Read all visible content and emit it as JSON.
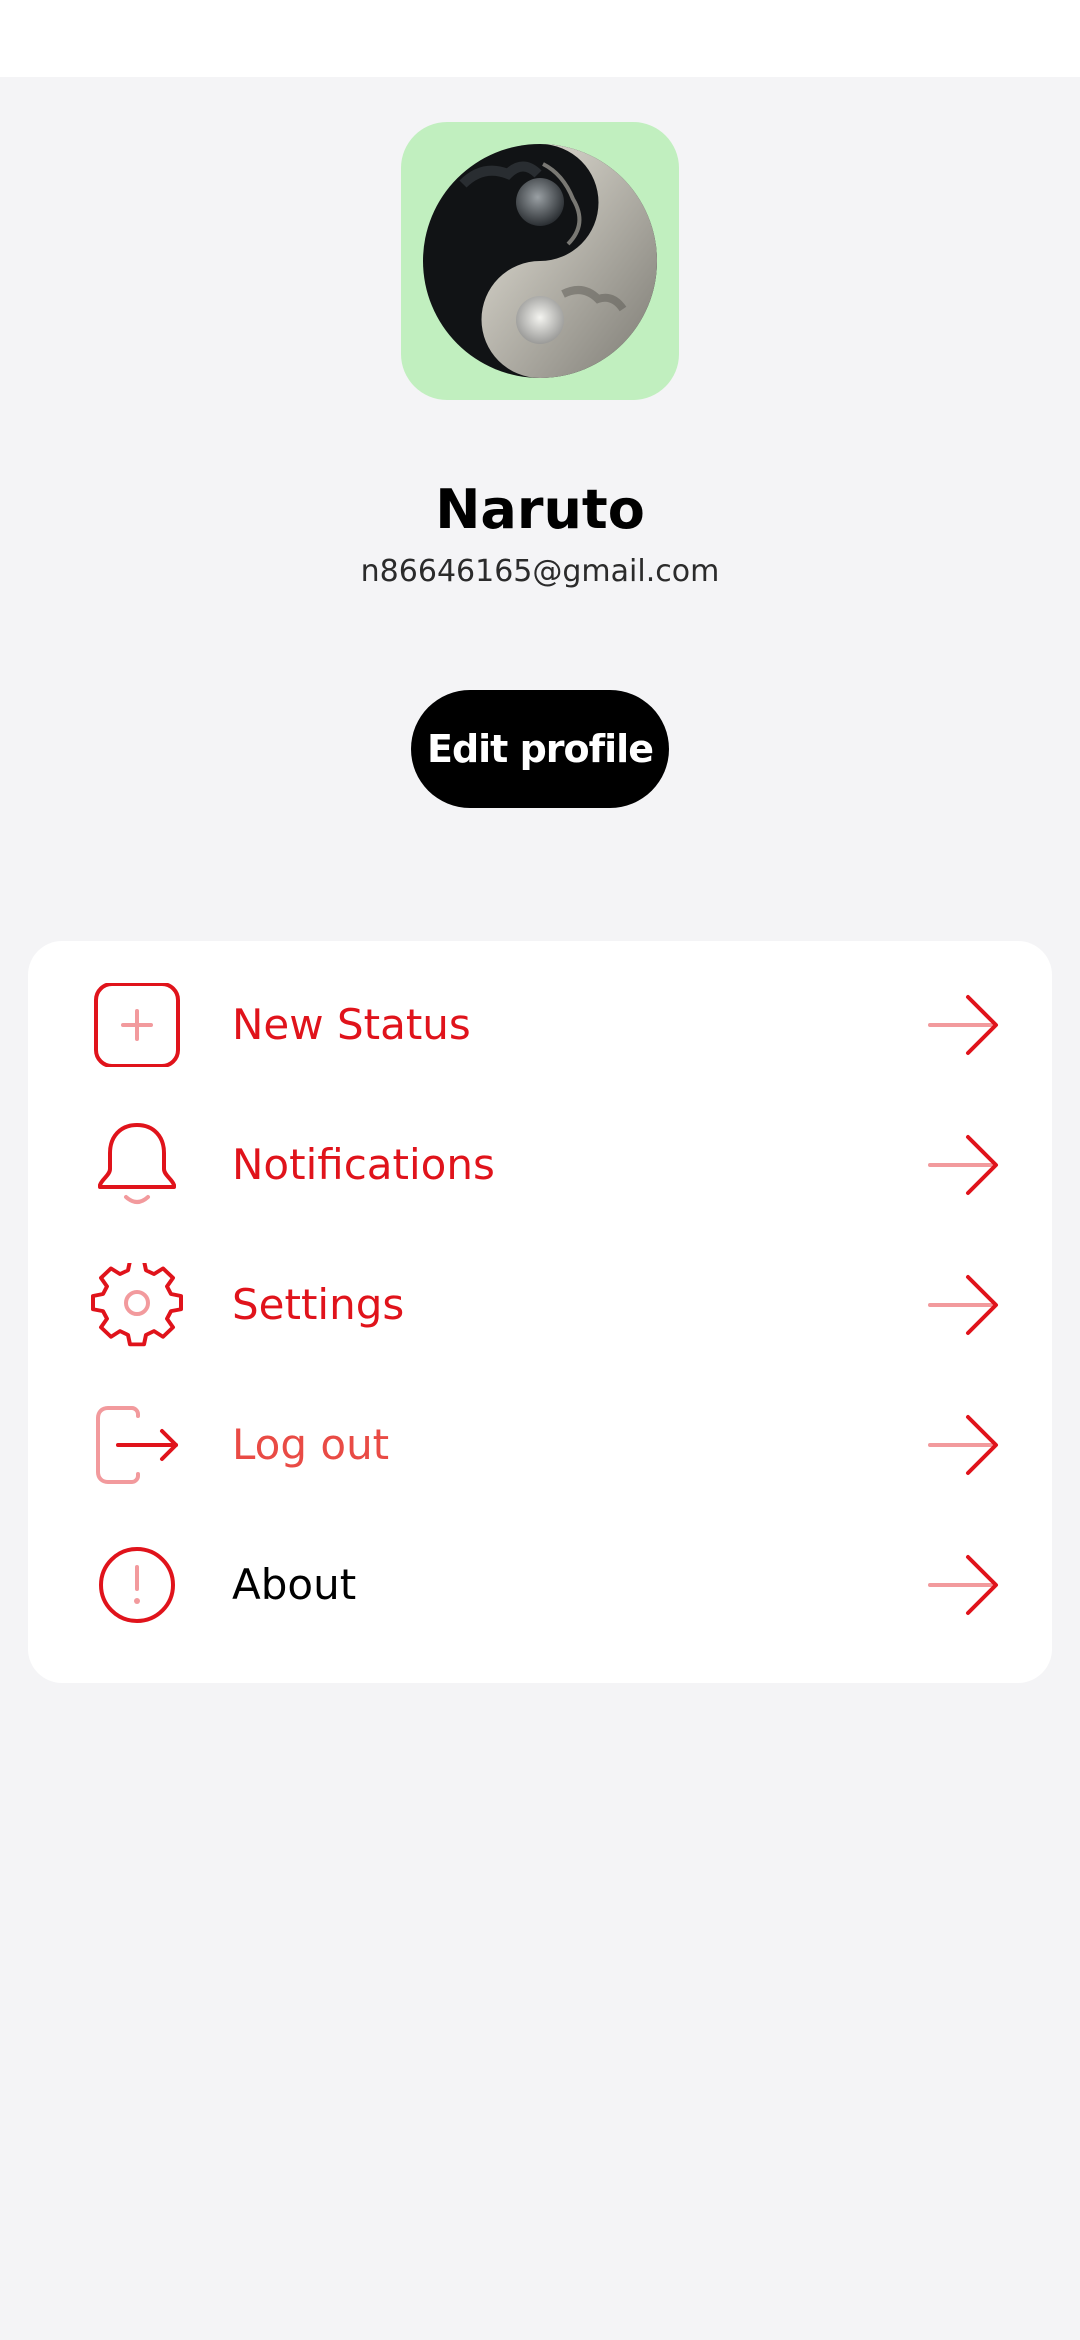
{
  "profile": {
    "name": "Naruto",
    "email": "n86646165@gmail.com",
    "edit_label": "Edit profile",
    "avatar_bg": "#c1efbf"
  },
  "menu": {
    "items": [
      {
        "label": "New Status",
        "icon": "add-square-icon",
        "color": "#e0131b"
      },
      {
        "label": "Notifications",
        "icon": "bell-icon",
        "color": "#e0131b"
      },
      {
        "label": "Settings",
        "icon": "gear-icon",
        "color": "#e0131b"
      },
      {
        "label": "Log out",
        "icon": "logout-icon",
        "color": "#e94b45"
      },
      {
        "label": "About",
        "icon": "info-icon",
        "color": "#000000"
      }
    ],
    "arrow_icon": "arrow-right-icon"
  },
  "colors": {
    "accent": "#e0131b",
    "accent_light": "#f29a9d",
    "background": "#f4f4f6",
    "card": "#ffffff"
  }
}
